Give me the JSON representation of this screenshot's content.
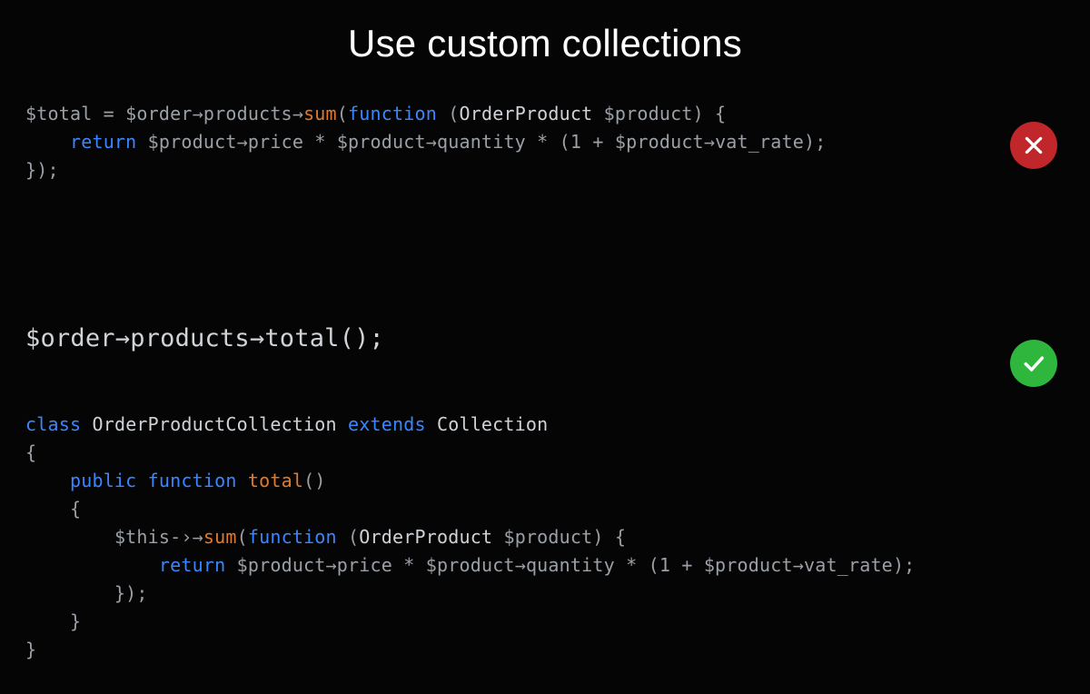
{
  "title": "Use custom collections",
  "tokens": {
    "total_eq": "$total = $order",
    "arrow": "→",
    "products": "products",
    "sum": "sum",
    "open_fn": "(",
    "function": "function",
    "space": " ",
    "open_paren": "(",
    "OrderProduct": "OrderProduct",
    "dollar_product": "$product",
    "close_paren_brace": ") {",
    "indent1": "    ",
    "indent2": "        ",
    "indent3": "            ",
    "return": "return",
    "price": "price",
    "star": " * ",
    "quantity": "quantity",
    "one_plus": " * (1 + ",
    "vat_rate": "vat_rate",
    "end_line": ");",
    "close_block": "});",
    "order_expr_prefix": "$order",
    "total_call": "total",
    "parens_semi": "();",
    "class": "class",
    "OrderProductCollection": "OrderProductCollection",
    "extends": "extends",
    "Collection": "Collection",
    "open_brace": "{",
    "public": "public",
    "total_def": "total",
    "empty_parens": "()",
    "this_arrow": "$this-›",
    "close_brace": "}",
    "close_brace_indent1": "    }",
    "close_brace_indent2": "        }",
    "close_block_indent2": "        });"
  },
  "status": {
    "bad": "incorrect",
    "good": "correct"
  }
}
